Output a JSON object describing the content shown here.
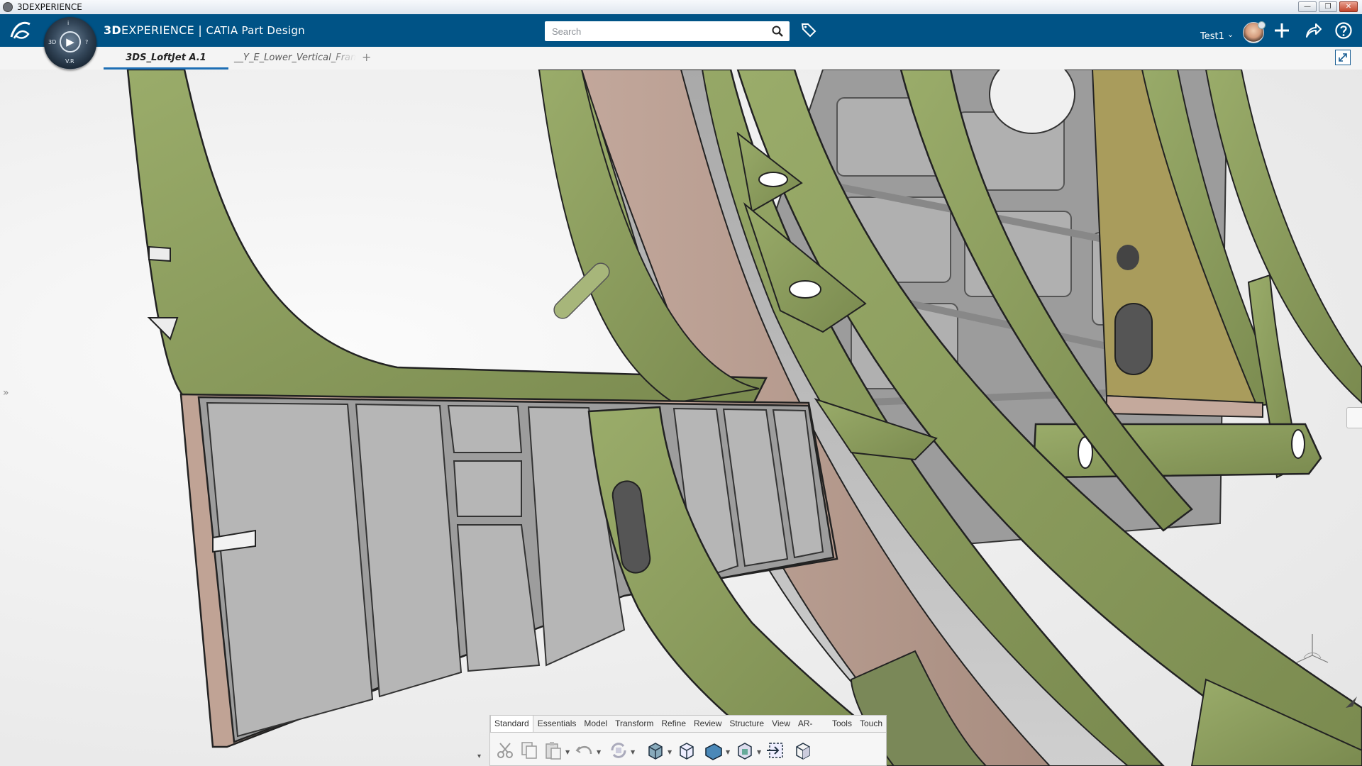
{
  "window": {
    "title": "3DEXPERIENCE",
    "controls": [
      "—",
      "❐",
      "✕"
    ]
  },
  "topbar": {
    "brand_bold": "3D",
    "brand_rest": "EXPERIENCE",
    "brand_separator": " | ",
    "brand_app": "CATIA Part Design",
    "compass_quadrants": [
      "3D",
      "V.R",
      "i",
      "?"
    ],
    "search_placeholder": "Search",
    "user_name": "Test1",
    "user_caret": "⌄",
    "accent_color": "#005386"
  },
  "tabs": {
    "items": [
      {
        "label": "3DS_LoftJet A.1",
        "active": true
      },
      {
        "label": "__Y_E_Lower_Vertical_Frame",
        "active": false
      }
    ],
    "add_label": "+"
  },
  "viewport": {
    "left_toggle": "»",
    "part_colors": {
      "green": "#8a9a5c",
      "pink": "#b79a8e",
      "grey": "#9d9d9d",
      "yellow": "#a69a5a"
    }
  },
  "action_bar": {
    "tabs": [
      {
        "label": "Standard",
        "active": true
      },
      {
        "label": "Essentials",
        "active": false
      },
      {
        "label": "Model",
        "active": false
      },
      {
        "label": "Transform",
        "active": false
      },
      {
        "label": "Refine",
        "active": false
      },
      {
        "label": "Review",
        "active": false
      },
      {
        "label": "Structure",
        "active": false
      },
      {
        "label": "View",
        "active": false
      },
      {
        "label": "AR-VR",
        "active": false
      },
      {
        "label": "Tools",
        "active": false
      },
      {
        "label": "Touch",
        "active": false
      }
    ],
    "tools": [
      "cut-icon",
      "copy-icon",
      "paste-icon",
      "undo-icon",
      "update-icon",
      "extrude-icon",
      "cube-icon",
      "box-solid-icon",
      "multi-view-icon",
      "export-icon",
      "view-cube-icon"
    ]
  }
}
